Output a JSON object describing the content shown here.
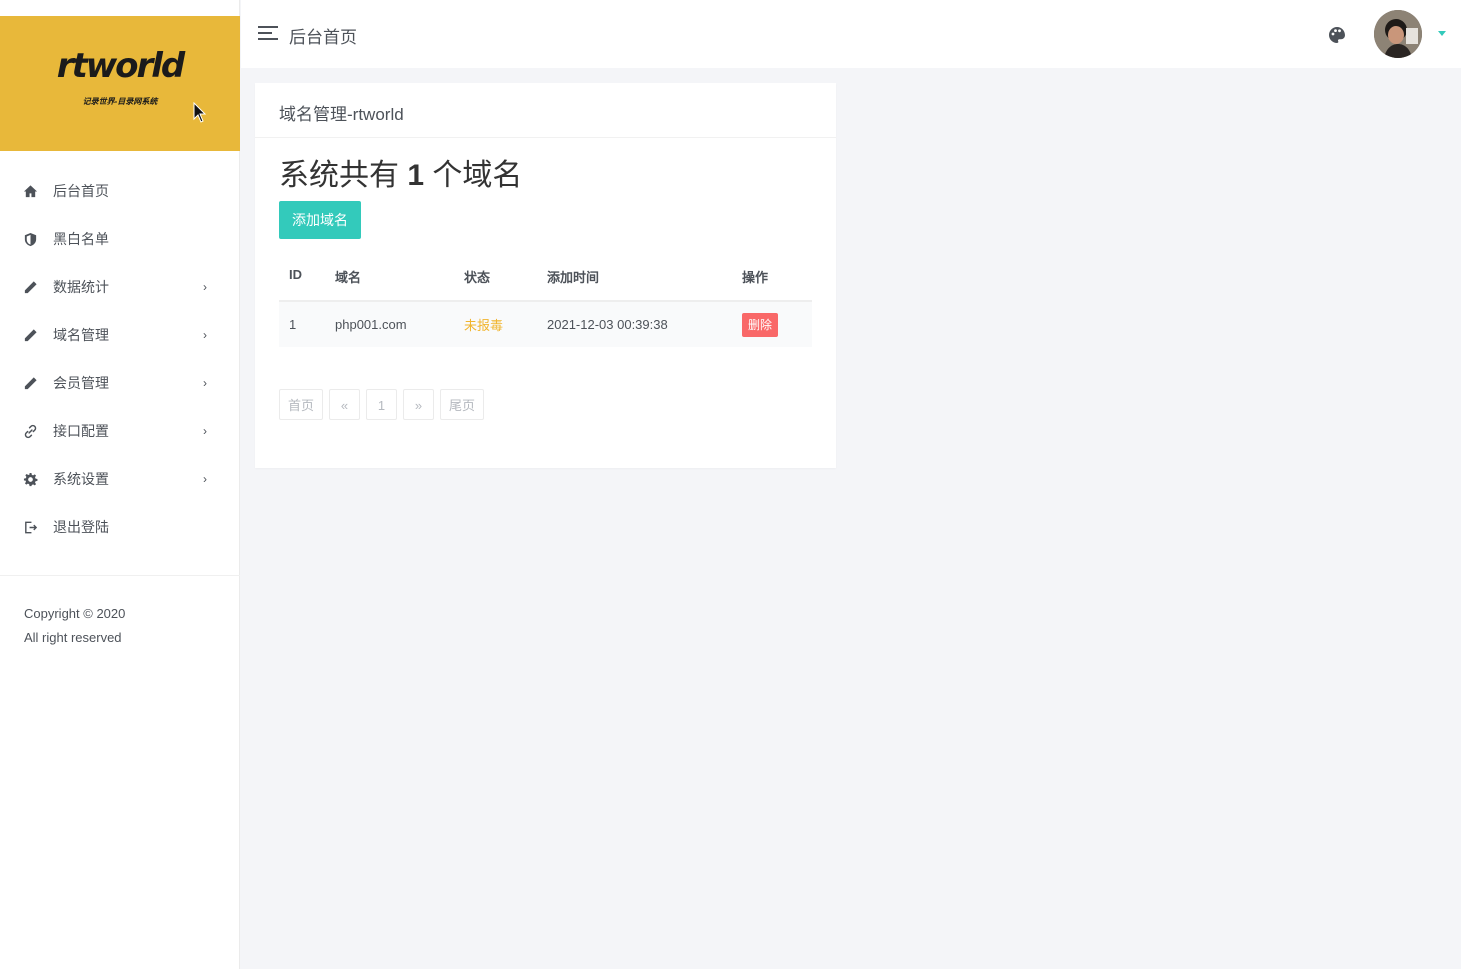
{
  "sidebar": {
    "logo_text": "rtworld",
    "logo_subtitle": "记录世界-目录网系统",
    "items": [
      {
        "label": "后台首页",
        "icon": "home-icon",
        "has_arrow": false
      },
      {
        "label": "黑白名单",
        "icon": "shield-icon",
        "has_arrow": false
      },
      {
        "label": "数据统计",
        "icon": "pencil-icon",
        "has_arrow": true
      },
      {
        "label": "域名管理",
        "icon": "pencil-icon",
        "has_arrow": true
      },
      {
        "label": "会员管理",
        "icon": "pencil-icon",
        "has_arrow": true
      },
      {
        "label": "接口配置",
        "icon": "link-icon",
        "has_arrow": true
      },
      {
        "label": "系统设置",
        "icon": "gear-icon",
        "has_arrow": true
      },
      {
        "label": "退出登陆",
        "icon": "logout-icon",
        "has_arrow": false
      }
    ],
    "arrow": "›",
    "copyright_line1": "Copyright © 2020",
    "copyright_line2": "All right reserved"
  },
  "topbar": {
    "title": "后台首页",
    "icons": [
      "hamburger-icon",
      "palette-icon",
      "avatar",
      "caret-down-icon"
    ]
  },
  "card": {
    "title": "域名管理-rtworld",
    "count_prefix": "系统共有",
    "count": "1",
    "count_suffix": "个域名",
    "add_button": "添加域名",
    "table": {
      "headers": [
        "ID",
        "域名",
        "状态",
        "添加时间",
        "操作"
      ],
      "rows": [
        {
          "id": "1",
          "domain": "php001.com",
          "status": "未报毒",
          "added": "2021-12-03 00:39:38",
          "action": "删除"
        }
      ]
    },
    "pager": {
      "first": "首页",
      "prev": "«",
      "page": "1",
      "next": "»",
      "last": "尾页"
    }
  },
  "colors": {
    "accent": "#33cabb",
    "danger": "#f96868",
    "warning": "#f1b52e",
    "logo_bg": "#e8b83a"
  }
}
